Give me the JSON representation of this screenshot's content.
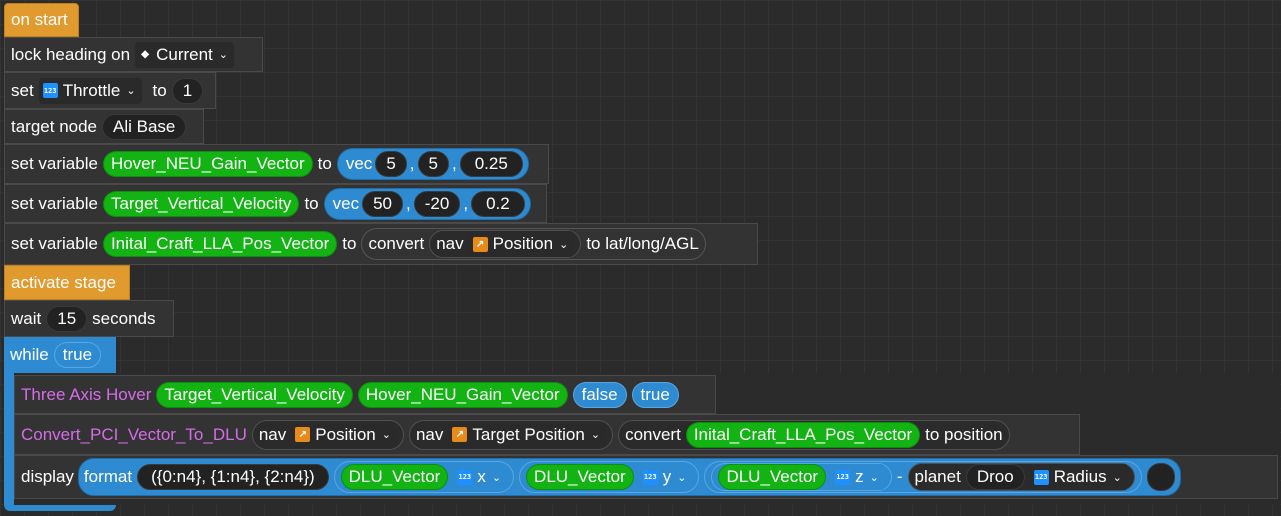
{
  "blocks": {
    "on_start": "on start",
    "lock_heading": {
      "label": "lock heading on",
      "value": "Current"
    },
    "set_throttle": {
      "label": "set",
      "var": "Throttle",
      "to": "to",
      "value": "1"
    },
    "target_node": {
      "label": "target node",
      "value": "Ali Base"
    },
    "set_gain": {
      "label": "set variable",
      "var": "Hover_NEU_Gain_Vector",
      "to": "to",
      "vec": "vec",
      "x": "5",
      "y": "5",
      "z": "0.25"
    },
    "set_velocity": {
      "label": "set variable",
      "var": "Target_Vertical_Velocity",
      "to": "to",
      "vec": "vec",
      "x": "50",
      "y": "-20",
      "z": "0.2"
    },
    "set_lla": {
      "label": "set variable",
      "var": "Inital_Craft_LLA_Pos_Vector",
      "to": "to",
      "convert": "convert",
      "nav": "nav",
      "nav_value": "Position",
      "suffix": "to lat/long/AGL"
    },
    "activate_stage": "activate stage",
    "wait": {
      "label": "wait",
      "value": "15",
      "suffix": "seconds"
    },
    "while": {
      "label": "while",
      "cond": "true"
    },
    "three_axis": {
      "label": "Three Axis Hover",
      "arg1": "Target_Vertical_Velocity",
      "arg2": "Hover_NEU_Gain_Vector",
      "arg3": "false",
      "arg4": "true"
    },
    "convert_pci": {
      "label": "Convert_PCI_Vector_To_DLU",
      "nav1": "nav",
      "nav1_value": "Position",
      "nav2": "nav",
      "nav2_value": "Target Position",
      "convert": "convert",
      "var": "Inital_Craft_LLA_Pos_Vector",
      "suffix": "to position"
    },
    "display": {
      "label": "display",
      "format": "format",
      "fmt": "({0:n4}, {1:n4}, {2:n4})",
      "v1": "DLU_Vector",
      "c1": "x",
      "v2": "DLU_Vector",
      "c2": "y",
      "v3": "DLU_Vector",
      "c3": "z",
      "minus": "-",
      "planet": "planet",
      "planet_name": "Droo",
      "prop": "Radius"
    }
  },
  "icons": {
    "number": "123",
    "position": "↗",
    "diamond": "◆",
    "chevron": "⌄"
  },
  "colors": {
    "event": "#e09a2e",
    "control": "#2e8bd1",
    "variable": "#12b312",
    "custom": "#d56ce8"
  }
}
